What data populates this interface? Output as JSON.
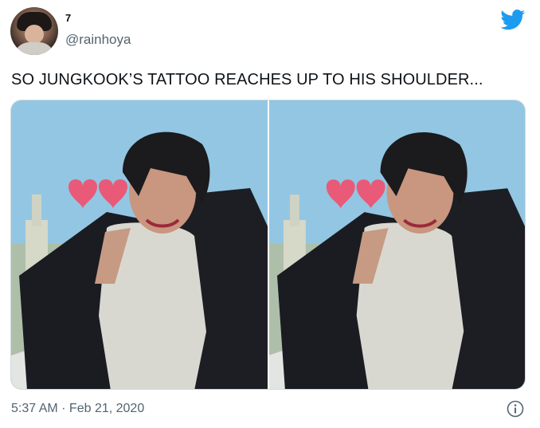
{
  "tweet": {
    "display_name": "7",
    "handle": "@rainhoya",
    "text": "SO JUNGKOOK’S TATTOO REACHES UP TO HIS SHOULDER...",
    "timestamp": "5:37 AM · Feb 21, 2020"
  },
  "icons": {
    "brand": "twitter-bird-icon",
    "info": "info-icon"
  },
  "colors": {
    "brand": "#1d9bf0",
    "secondary_text": "#536471",
    "heart": "#e85a78"
  },
  "media": {
    "photo_count": 2
  }
}
